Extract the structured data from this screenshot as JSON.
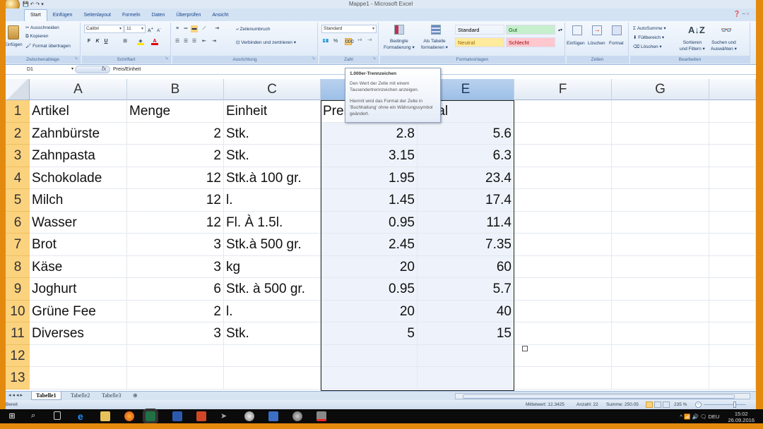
{
  "window": {
    "title": "Mappe1 - Microsoft Excel",
    "help_icons": "? - ▫"
  },
  "ribbon": {
    "tabs": [
      "Start",
      "Einfügen",
      "Seitenlayout",
      "Formeln",
      "Daten",
      "Überprüfen",
      "Ansicht"
    ],
    "active_tab": "Start",
    "clipboard": {
      "paste": "Einfügen",
      "cut": "Ausschneiden",
      "copy": "Kopieren",
      "format_painter": "Format übertragen",
      "label": "Zwischenablage"
    },
    "font": {
      "font_name": "Calibri",
      "font_size": "11",
      "bold": "F",
      "italic": "K",
      "underline": "U",
      "label": "Schriftart"
    },
    "alignment": {
      "wrap_text": "Zeilenumbruch",
      "merge_center": "Verbinden und zentrieren",
      "label": "Ausrichtung"
    },
    "number": {
      "format": "Standard",
      "label": "Zahl"
    },
    "styles": {
      "conditional_formatting": [
        "Bedingte",
        "Formatierung"
      ],
      "format_as_table": [
        "Als Tabelle",
        "formatieren"
      ],
      "cell_styles": [
        {
          "name": "Standard",
          "bg": "#ffffff",
          "color": "#222222"
        },
        {
          "name": "Gut",
          "bg": "#c6efce",
          "color": "#006100"
        },
        {
          "name": "Neutral",
          "bg": "#ffeb9c",
          "color": "#9c6500"
        },
        {
          "name": "Schlecht",
          "bg": "#ffc7ce",
          "color": "#9c0006"
        }
      ],
      "label": "Formatvorlagen"
    },
    "cells": {
      "insert": "Einfügen",
      "delete": "Löschen",
      "format": "Format",
      "label": "Zellen"
    },
    "editing": {
      "autosum": "AutoSumme",
      "fill": "Füllbereich",
      "clear": "Löschen",
      "sort_filter": [
        "Sortieren",
        "und Filtern"
      ],
      "find_select": [
        "Suchen und",
        "Auswählen"
      ],
      "label": "Bearbeiten"
    }
  },
  "tooltip": {
    "title": "1.000er-Trennzeichen",
    "line1": "Den Wert der Zelle mit einem Tausendertrennzeichen anzeigen.",
    "line2": "Hiermit wird das Format der Zelle in 'Buchhaltung' ohne ein Währungssymbol geändert."
  },
  "formula_bar": {
    "name_box": "D1",
    "fx": "fx",
    "content": "Preis/Einheit"
  },
  "sheet": {
    "columns": [
      "A",
      "B",
      "C",
      "D",
      "E",
      "F",
      "G"
    ],
    "selected_column": "D",
    "rows": [
      {
        "n": "1",
        "A": "Artikel",
        "B": "Menge",
        "C": "Einheit",
        "D": "Preis/Einheit",
        "E": "Total"
      },
      {
        "n": "2",
        "A": "Zahnbürste",
        "B": "2",
        "C": "Stk.",
        "D": "2.8",
        "E": "5.6"
      },
      {
        "n": "3",
        "A": "Zahnpasta",
        "B": "2",
        "C": "Stk.",
        "D": "3.15",
        "E": "6.3"
      },
      {
        "n": "4",
        "A": "Schokolade",
        "B": "12",
        "C": "Stk.à 100 gr.",
        "D": "1.95",
        "E": "23.4"
      },
      {
        "n": "5",
        "A": "Milch",
        "B": "12",
        "C": "l.",
        "D": "1.45",
        "E": "17.4"
      },
      {
        "n": "6",
        "A": "Wasser",
        "B": "12",
        "C": "Fl. À 1.5l.",
        "D": "0.95",
        "E": "11.4"
      },
      {
        "n": "7",
        "A": "Brot",
        "B": "3",
        "C": "Stk.à 500 gr.",
        "D": "2.45",
        "E": "7.35"
      },
      {
        "n": "8",
        "A": "Käse",
        "B": "3",
        "C": "kg",
        "D": "20",
        "E": "60"
      },
      {
        "n": "9",
        "A": "Joghurt",
        "B": "6",
        "C": "Stk. à 500 gr.",
        "D": "0.95",
        "E": "5.7"
      },
      {
        "n": "10",
        "A": "Grüne Fee",
        "B": "2",
        "C": "l.",
        "D": "20",
        "E": "40"
      },
      {
        "n": "11",
        "A": "Diverses",
        "B": "3",
        "C": "Stk.",
        "D": "5",
        "E": "15"
      },
      {
        "n": "12",
        "A": "",
        "B": "",
        "C": "",
        "D": "",
        "E": ""
      },
      {
        "n": "13",
        "A": "",
        "B": "",
        "C": "",
        "D": "",
        "E": ""
      }
    ]
  },
  "sheet_tabs": [
    "Tabelle1",
    "Tabelle2",
    "Tabelle3"
  ],
  "active_sheet": "Tabelle1",
  "status": {
    "mode": "Bereit",
    "average": "Mittelwert: 12.3425",
    "count": "Anzahl: 22",
    "sum": "Summe: 250.05",
    "zoom": "235 %"
  },
  "taskbar": {
    "language": "DEU",
    "time": "15:02",
    "date": "26.09.2016"
  }
}
